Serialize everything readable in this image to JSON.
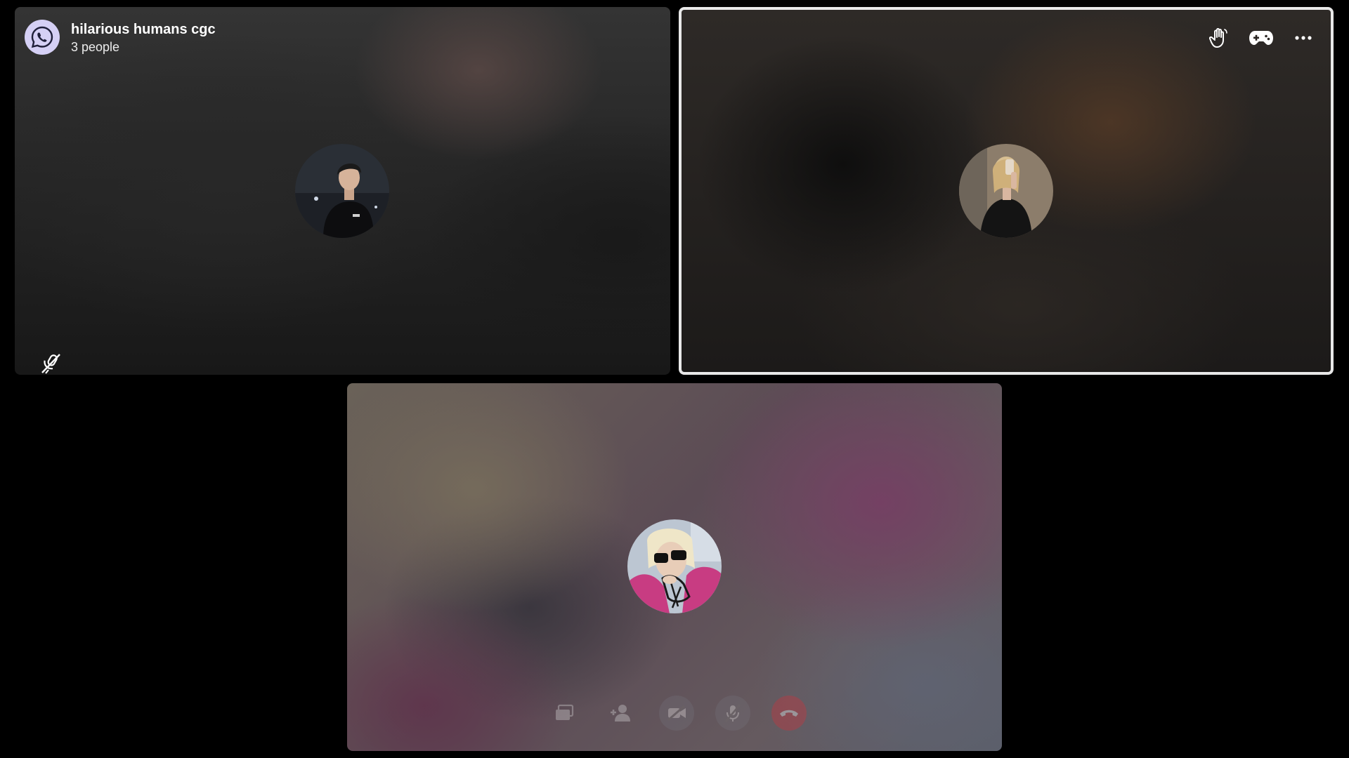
{
  "call": {
    "title": "hilarious humans cgc",
    "participant_count": "3 people"
  },
  "top_actions": [
    {
      "name": "raise-hand",
      "icon": "raised-hand-icon"
    },
    {
      "name": "games",
      "icon": "gamepad-icon"
    },
    {
      "name": "more-options",
      "icon": "ellipsis-icon"
    }
  ],
  "participants": [
    {
      "position": "top-left",
      "avatar": "male-profile-photo",
      "muted": true,
      "active_speaker": false
    },
    {
      "position": "top-right",
      "avatar": "female-mirror-selfie-photo",
      "muted": false,
      "active_speaker": true
    },
    {
      "position": "bottom-center",
      "avatar": "blonde-sunglasses-photo",
      "muted": false,
      "active_speaker": false
    }
  ],
  "controls": [
    {
      "name": "share-screen",
      "icon": "screen-share-icon"
    },
    {
      "name": "add-person",
      "icon": "add-person-icon"
    },
    {
      "name": "camera-off",
      "icon": "video-off-icon"
    },
    {
      "name": "mic-off",
      "icon": "mic-off-icon"
    },
    {
      "name": "end-call",
      "icon": "phone-hangup-icon"
    }
  ],
  "colors": {
    "background": "#000000",
    "active_border": "#e8e8e8",
    "logo_bg": "#d5d0f5",
    "end_call": "#d3303a"
  }
}
